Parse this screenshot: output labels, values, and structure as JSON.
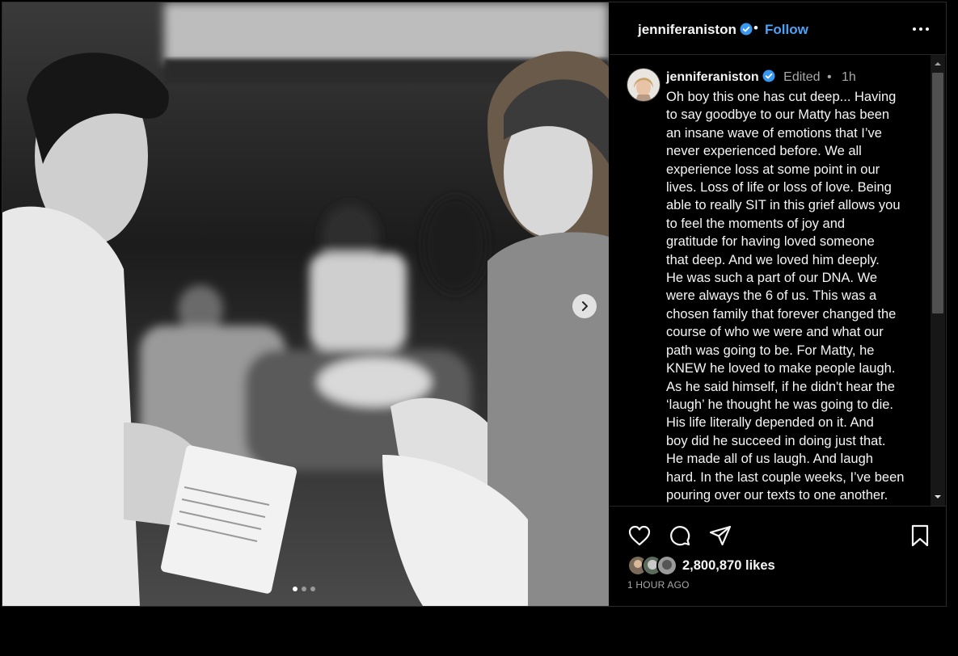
{
  "header": {
    "username": "jenniferaniston",
    "separator": "•",
    "follow_label": "Follow"
  },
  "media": {
    "description_icon": "photo",
    "carousel_total": 3,
    "carousel_active": 1
  },
  "caption": {
    "username": "jenniferaniston",
    "edited": "Edited",
    "separator": "•",
    "time": "1h",
    "text": "Oh boy this one has cut deep... Having\nto say goodbye to our Matty has been\nan insane wave of emotions that I’ve\nnever experienced before. We all\nexperience loss at some point in our\nlives. Loss of life or loss of love. Being\nable to really SIT in this grief allows you\nto feel the moments of joy and\ngratitude for having loved someone\nthat deep. And we loved him deeply.\nHe was such a part of our DNA. We\nwere always the 6 of us. This was a\nchosen family that forever changed the\ncourse of who we were and what our\npath was going to be. For Matty, he\nKNEW he loved to make people laugh.\nAs he said himself, if he didn't hear the\n‘laugh’ he thought he was going to die.\nHis life literally depended on it. And\nboy did he succeed in doing just that.\nHe made all of us laugh. And laugh\nhard. In the last couple weeks, I’ve been\npouring over our texts to one another."
  },
  "actions": {
    "icons": [
      "heart-icon",
      "comment-icon",
      "share-icon",
      "bookmark-icon"
    ],
    "likes_label": "2,800,870 likes",
    "time_ago": "1 HOUR AGO"
  },
  "colors": {
    "accent": "#4aa3f5",
    "verified": "#3897f0",
    "background": "#000000",
    "muted": "#a8a8a8"
  }
}
